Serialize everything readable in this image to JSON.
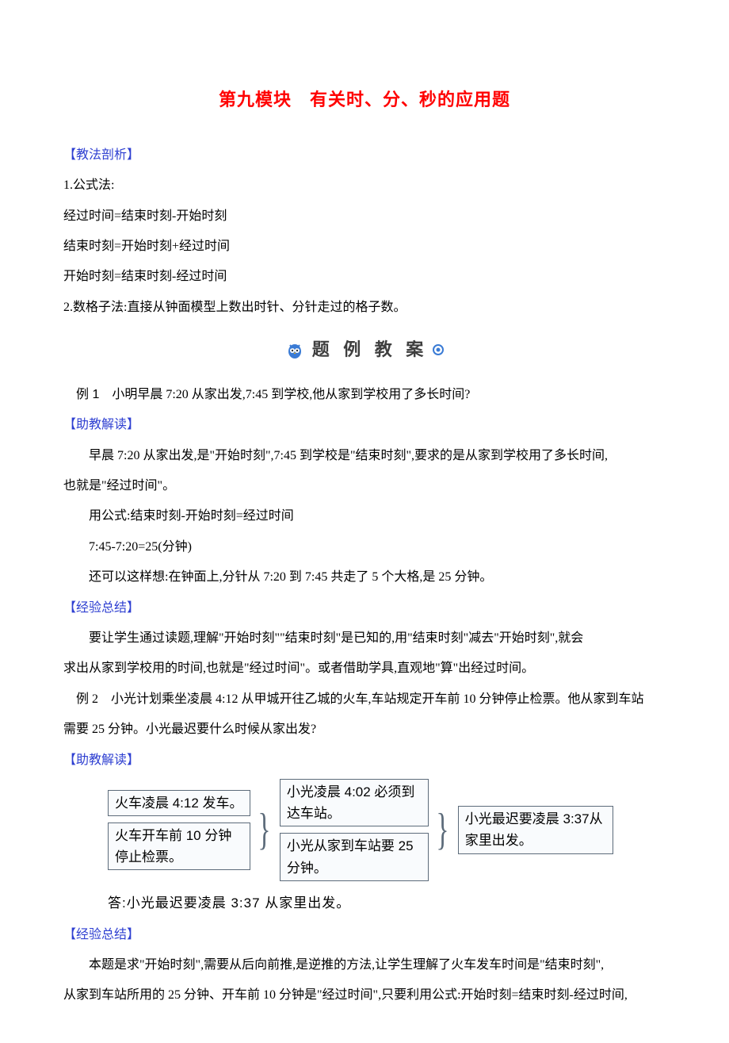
{
  "title": "第九模块　有关时、分、秒的应用题",
  "s1_label": "【教法剖析】",
  "s1_p1": "1.公式法:",
  "s1_p2": "经过时间=结束时刻-开始时刻",
  "s1_p3": "结束时刻=开始时刻+经过时间",
  "s1_p4": "开始时刻=结束时刻-经过时间",
  "s1_p5": "2.数格子法:直接从钟面模型上数出时针、分针走过的格子数。",
  "banner_text": "题 例 教 案",
  "ex1_label": "例 1",
  "ex1_text": "　小明早晨 7:20 从家出发,7:45 到学校,他从家到学校用了多长时间?",
  "s2a_label": "【助教解读】",
  "s2a_p1": "早晨 7:20 从家出发,是\"开始时刻\",7:45 到学校是\"结束时刻\",要求的是从家到学校用了多长时间,",
  "s2a_p2": "也就是\"经过时间\"。",
  "s2a_p3": "用公式:结束时刻-开始时刻=经过时间",
  "s2a_p4": "7:45-7:20=25(分钟)",
  "s2a_p5": "还可以这样想:在钟面上,分针从 7:20 到 7:45 共走了 5 个大格,是 25 分钟。",
  "s3a_label": "【经验总结】",
  "s3a_p1": "要让学生通过读题,理解\"开始时刻\"\"结束时刻\"是已知的,用\"结束时刻\"减去\"开始时刻\",就会",
  "s3a_p2": "求出从家到学校用的时间,也就是\"经过时间\"。或者借助学具,直观地\"算\"出经过时间。",
  "ex2_label": "例 2",
  "ex2_text": "　小光计划乘坐凌晨 4:12 从甲城开往乙城的火车,车站规定开车前 10 分钟停止检票。他从家到车站",
  "ex2_text2": "需要 25 分钟。小光最迟要什么时候从家出发?",
  "s2b_label": "【助教解读】",
  "diagram": {
    "b1": "火车凌晨 4:12 发车。",
    "b2": "火车开车前 10 分钟停止检票。",
    "b3": "小光凌晨 4:02 必须到达车站。",
    "b4": "小光从家到车站要 25分钟。",
    "b5": "小光最迟要凌晨 3:37从家里出发。"
  },
  "answer": "答:小光最迟要凌晨 3:37 从家里出发。",
  "s3b_label": "【经验总结】",
  "s3b_p1": "本题是求\"开始时刻\",需要从后向前推,是逆推的方法,让学生理解了火车发车时间是\"结束时刻\",",
  "s3b_p2": "从家到车站所用的 25 分钟、开车前 10 分钟是\"经过时间\",只要利用公式:开始时刻=结束时刻-经过时间,"
}
